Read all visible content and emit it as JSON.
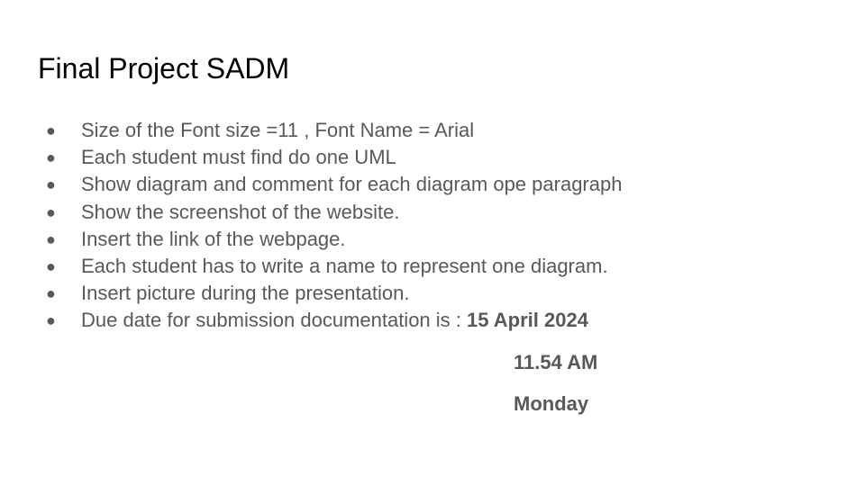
{
  "slide": {
    "title": "Final Project SADM",
    "bullets": [
      "Size of the Font size =11 , Font Name = Arial",
      "Each student must find do one UML",
      "Show diagram and comment for each diagram ope paragraph",
      "Show the screenshot of the website.",
      "Insert the link of the webpage.",
      "Each student has to write a name to represent one diagram.",
      "Insert picture during the presentation."
    ],
    "due": {
      "prefix": "Due date for submission documentation is : ",
      "date": "15 April 2024",
      "time": "11.54 AM",
      "day": "Monday"
    },
    "bullet_symbol": "●",
    "colors": {
      "title": "#000000",
      "body": "#595959",
      "background": "#ffffff"
    }
  }
}
